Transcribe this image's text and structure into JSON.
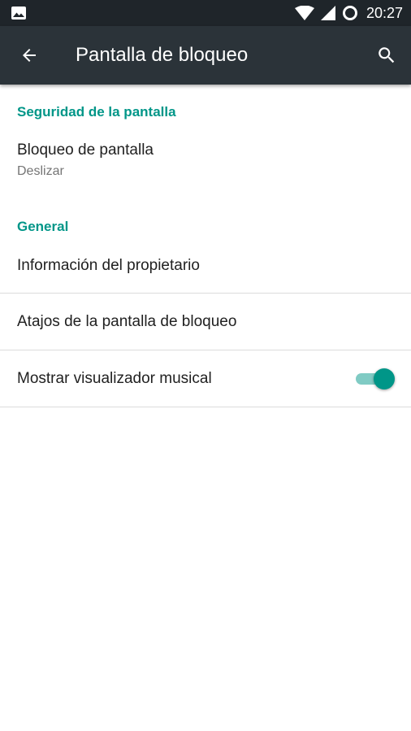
{
  "status_bar": {
    "time": "20:27",
    "icons": [
      "image-notification-icon",
      "wifi-icon",
      "cell-signal-icon",
      "battery-circle-icon"
    ]
  },
  "toolbar": {
    "title": "Pantalla de bloqueo",
    "back_icon": "arrow-back-icon",
    "search_icon": "search-icon"
  },
  "sections": [
    {
      "header": "Seguridad de la pantalla",
      "items": [
        {
          "title": "Bloqueo de pantalla",
          "summary": "Deslizar"
        }
      ]
    },
    {
      "header": "General",
      "items": [
        {
          "title": "Información del propietario"
        },
        {
          "title": "Atajos de la pantalla de bloqueo"
        },
        {
          "title": "Mostrar visualizador musical",
          "switch_on": true
        }
      ]
    }
  ],
  "colors": {
    "accent": "#009688",
    "toolbar": "#2b3339",
    "status_bar": "#1f252a"
  }
}
